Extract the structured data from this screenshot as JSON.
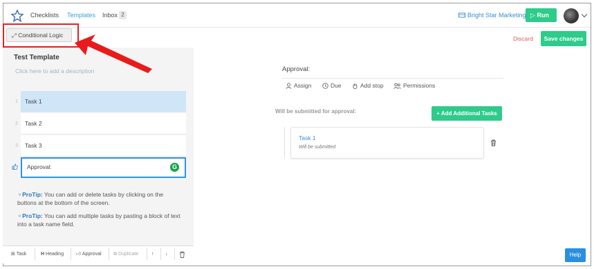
{
  "nav": {
    "links": [
      "Checklists",
      "Templates",
      "Inbox"
    ],
    "inbox_count": "2",
    "org_name": "Bright Star Marketing",
    "run_label": "Run"
  },
  "toolbar": {
    "conditional_logic_label": "Conditional Logic",
    "discard_label": "Discard",
    "save_label": "Save changes"
  },
  "template": {
    "title": "Test Template",
    "description_placeholder": "Click here to add a description",
    "tasks": [
      {
        "num": "1",
        "label": "Task 1"
      },
      {
        "num": "2",
        "label": "Task 2"
      },
      {
        "num": "3",
        "label": "Task 3"
      }
    ],
    "approval_label": "Approval:"
  },
  "protips": [
    {
      "head": "ProTip:",
      "text": " You can add or delete tasks by clicking on the buttons at the bottom of the screen."
    },
    {
      "head": "ProTip:",
      "text": " You can add multiple tasks by pasting a block of text into a task name field."
    }
  ],
  "bottom_toolbar": {
    "task": "Task",
    "heading": "Heading",
    "approval": "Approval",
    "duplicate": "Duplicate"
  },
  "approval_panel": {
    "title": "Approval:",
    "actions": [
      "Assign",
      "Due",
      "Add stop",
      "Permissions"
    ],
    "submitted_label": "Will be submitted for approval:",
    "add_tasks_label": "+ Add Additional Tasks",
    "card_title": "Task 1",
    "card_subtitle": "Will be submitted"
  },
  "help_label": "Help",
  "colors": {
    "accent_green": "#2ecb8b",
    "link_blue": "#36a3d9",
    "annotation_red": "#e32222"
  }
}
